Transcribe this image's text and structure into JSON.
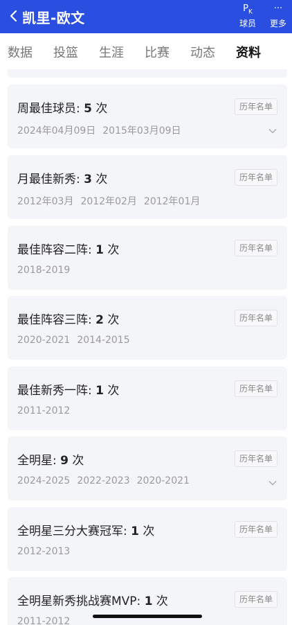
{
  "header": {
    "title": "凯里-欧文",
    "pk_glyph": "P",
    "pk_sub": "K",
    "pk_label": "球员",
    "more_glyph": "···",
    "more_label": "更多"
  },
  "tabs": [
    "数据",
    "投篮",
    "生涯",
    "比赛",
    "动态",
    "资料"
  ],
  "history_label": "历年名单",
  "awards": [
    {
      "name": "周最佳球员: ",
      "count": "5",
      "unit": " 次",
      "seasons": [
        "2024年04月09日",
        "2015年03月09日"
      ],
      "expandable": true
    },
    {
      "name": "月最佳新秀: ",
      "count": "3",
      "unit": " 次",
      "seasons": [
        "2012年03月",
        "2012年02月",
        "2012年01月"
      ],
      "expandable": false
    },
    {
      "name": "最佳阵容二阵: ",
      "count": "1",
      "unit": " 次",
      "seasons": [
        "2018-2019"
      ],
      "expandable": false
    },
    {
      "name": "最佳阵容三阵: ",
      "count": "2",
      "unit": " 次",
      "seasons": [
        "2020-2021",
        "2014-2015"
      ],
      "expandable": false
    },
    {
      "name": "最佳新秀一阵: ",
      "count": "1",
      "unit": " 次",
      "seasons": [
        "2011-2012"
      ],
      "expandable": false
    },
    {
      "name": "全明星: ",
      "count": "9",
      "unit": " 次",
      "seasons": [
        "2024-2025",
        "2022-2023",
        "2020-2021"
      ],
      "expandable": true
    },
    {
      "name": "全明星三分大赛冠军: ",
      "count": "1",
      "unit": " 次",
      "seasons": [
        "2012-2013"
      ],
      "expandable": false
    },
    {
      "name": "全明星新秀挑战赛MVP: ",
      "count": "1",
      "unit": " 次",
      "seasons": [
        "2011-2012"
      ],
      "expandable": false
    }
  ]
}
